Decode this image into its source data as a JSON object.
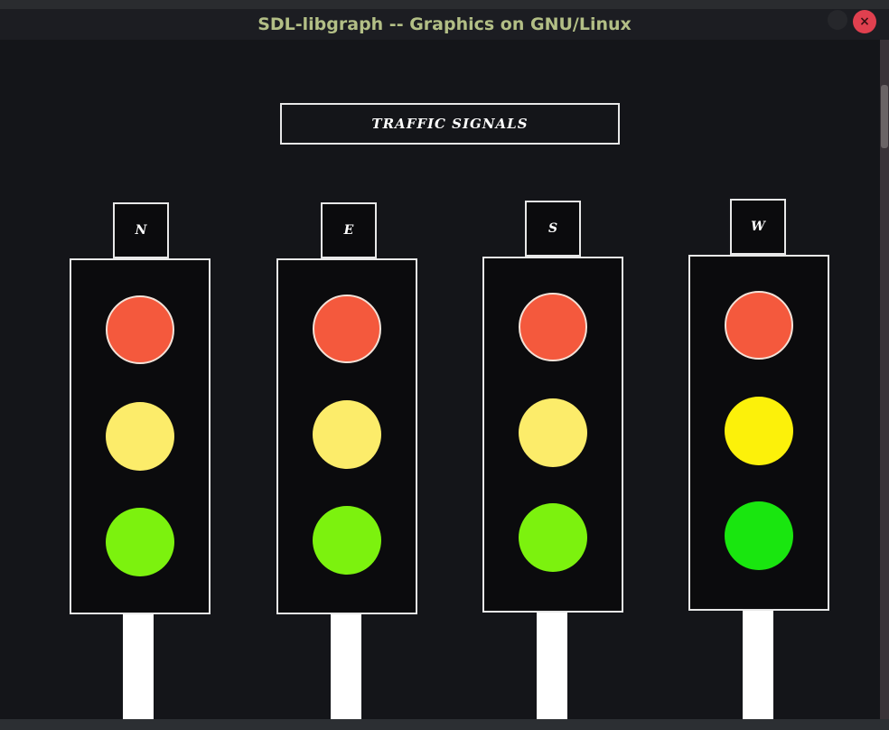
{
  "window": {
    "title": "SDL-libgraph -- Graphics on GNU/Linux",
    "close_glyph": "×"
  },
  "heading": "TRAFFIC SIGNALS",
  "colors": {
    "red_lamp": "#f4593d",
    "yellow_lamp_pale": "#fcec6a",
    "green_lamp_pale": "#7cf20e",
    "yellow_lamp_bright": "#fcf10a",
    "green_lamp_bright": "#19e60f",
    "frame": "#e8e8e8",
    "pole": "#ffffff"
  },
  "signals": [
    {
      "direction": "N",
      "lamps": [
        "red",
        "yellow",
        "green"
      ]
    },
    {
      "direction": "E",
      "lamps": [
        "red",
        "yellow",
        "green"
      ]
    },
    {
      "direction": "S",
      "lamps": [
        "red",
        "yellow",
        "green"
      ]
    },
    {
      "direction": "W",
      "lamps": [
        "red",
        "yellow",
        "green"
      ],
      "note": "yellow and green lamps brighter"
    }
  ]
}
